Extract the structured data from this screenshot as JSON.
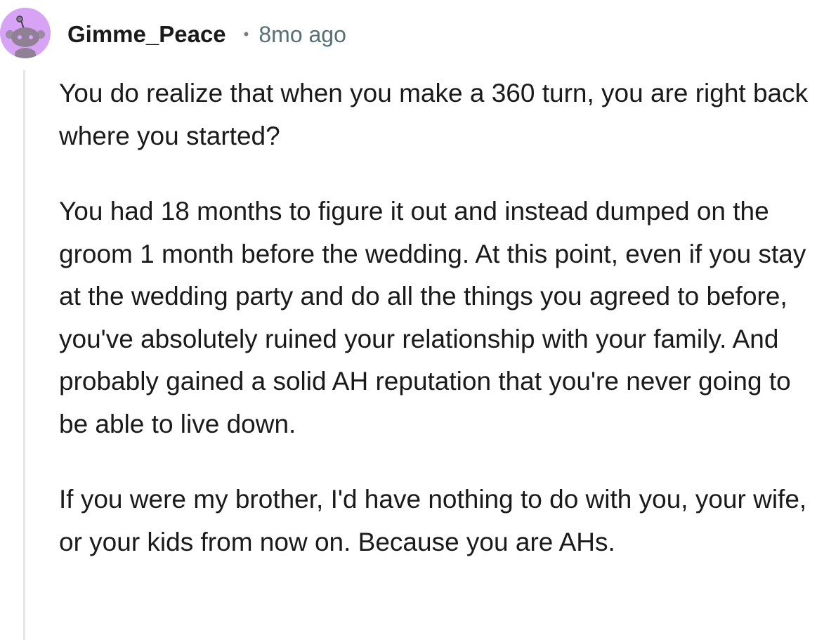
{
  "comment": {
    "username": "Gimme_Peace",
    "separator": "•",
    "timestamp": "8mo ago",
    "avatar_icon": "snoo-avatar-icon",
    "colors": {
      "avatar_bg": "#d7a3f5",
      "text": "#1a1a1b",
      "meta": "#576f76"
    },
    "paragraphs": [
      "You do realize that when you make a 360 turn, you are right back where you started?",
      "You had 18 months to figure it out and instead dumped on the groom 1 month before the wedding. At this point, even if you stay at the wedding party and do all the things you agreed to before, you've absolutely ruined your relationship with your family. And probably gained a solid AH reputation that you're never going to be able to live down.",
      "If you were my brother, I'd have nothing to do with you, your wife, or your kids from now on. Because you are AHs."
    ]
  }
}
